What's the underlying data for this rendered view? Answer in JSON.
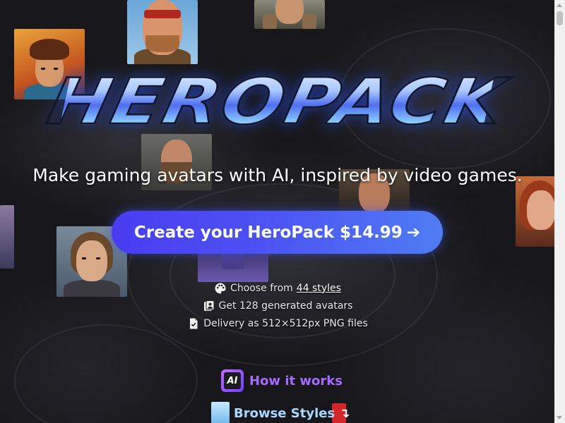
{
  "brand": {
    "logo_text": "HEROPACK"
  },
  "hero": {
    "tagline": "Make gaming avatars with AI, inspired by video games.",
    "cta_label": "Create your HeroPack $14.99",
    "cta_arrow": "➔"
  },
  "features": [
    {
      "icon": "palette-icon",
      "prefix": "Choose from ",
      "link": "44 styles"
    },
    {
      "icon": "avatars-icon",
      "text": "Get 128 generated avatars"
    },
    {
      "icon": "file-check-icon",
      "text": "Delivery as 512×512px PNG files"
    }
  ],
  "links": {
    "how_it_works": "How it works",
    "how_badge": "AI",
    "browse_styles": "Browse Styles",
    "browse_arrow": "↴"
  },
  "colors": {
    "cta_start": "#4a3cf2",
    "cta_end": "#4f7cf3",
    "how_it_works": "#a56bff",
    "browse_styles": "#a8d8ff"
  }
}
